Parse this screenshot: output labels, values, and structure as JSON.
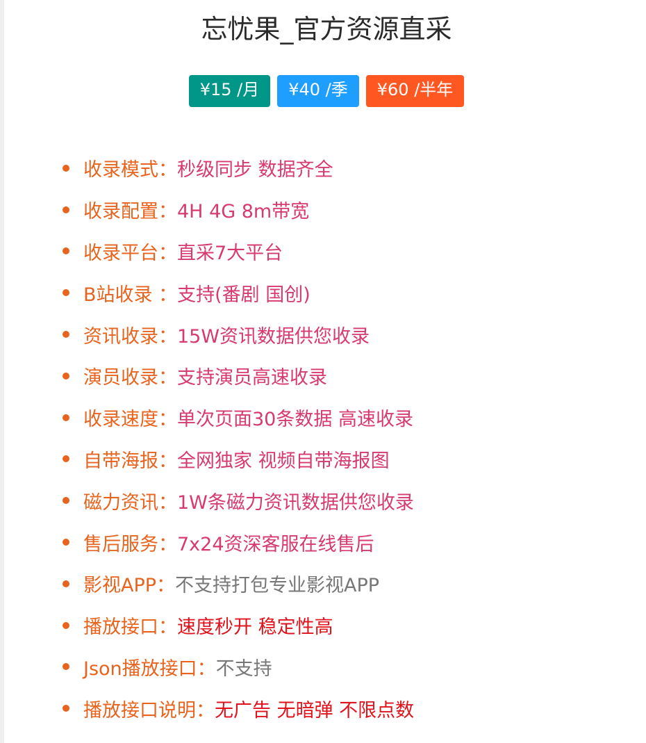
{
  "header": {
    "title": "忘忧果_官方资源直采"
  },
  "prices": [
    {
      "label": "¥15 /月",
      "color": "#009688"
    },
    {
      "label": "¥40 /季",
      "color": "#1e9fff"
    },
    {
      "label": "¥60 /半年",
      "color": "#ff5722"
    }
  ],
  "features": [
    {
      "label": "收录模式：",
      "value": "秒级同步 数据齐全",
      "value_color": "#d63a6f"
    },
    {
      "label": "收录配置：",
      "value": "4H 4G 8m带宽",
      "value_color": "#d63a6f"
    },
    {
      "label": "收录平台：",
      "value": "直采7大平台",
      "value_color": "#d63a6f"
    },
    {
      "label": "B站收录 ：",
      "value": "支持(番剧 国创)",
      "value_color": "#d63a6f"
    },
    {
      "label": "资讯收录：",
      "value": "15W资讯数据供您收录",
      "value_color": "#d63a6f"
    },
    {
      "label": "演员收录：",
      "value": "支持演员高速收录",
      "value_color": "#d63a6f"
    },
    {
      "label": "收录速度：",
      "value": "单次页面30条数据 高速收录",
      "value_color": "#d63a6f"
    },
    {
      "label": "自带海报：",
      "value": "全网独家 视频自带海报图",
      "value_color": "#d63a6f"
    },
    {
      "label": "磁力资讯：",
      "value": "1W条磁力资讯数据供您收录",
      "value_color": "#d63a6f"
    },
    {
      "label": "售后服务：",
      "value": "7x24资深客服在线售后",
      "value_color": "#d63a6f"
    },
    {
      "label": "影视APP：",
      "value": "不支持打包专业影视APP",
      "value_color": "#777777"
    },
    {
      "label": "播放接口：",
      "value": "速度秒开 稳定性高",
      "value_color": "#e0131d"
    },
    {
      "label": "Json播放接口：",
      "value": "不支持",
      "value_color": "#777777"
    },
    {
      "label": "播放接口说明：",
      "value": "无广告 无暗弹 不限点数",
      "value_color": "#e0131d"
    }
  ],
  "colors": {
    "label": "#e8641e",
    "bullet": "#e8641e"
  }
}
